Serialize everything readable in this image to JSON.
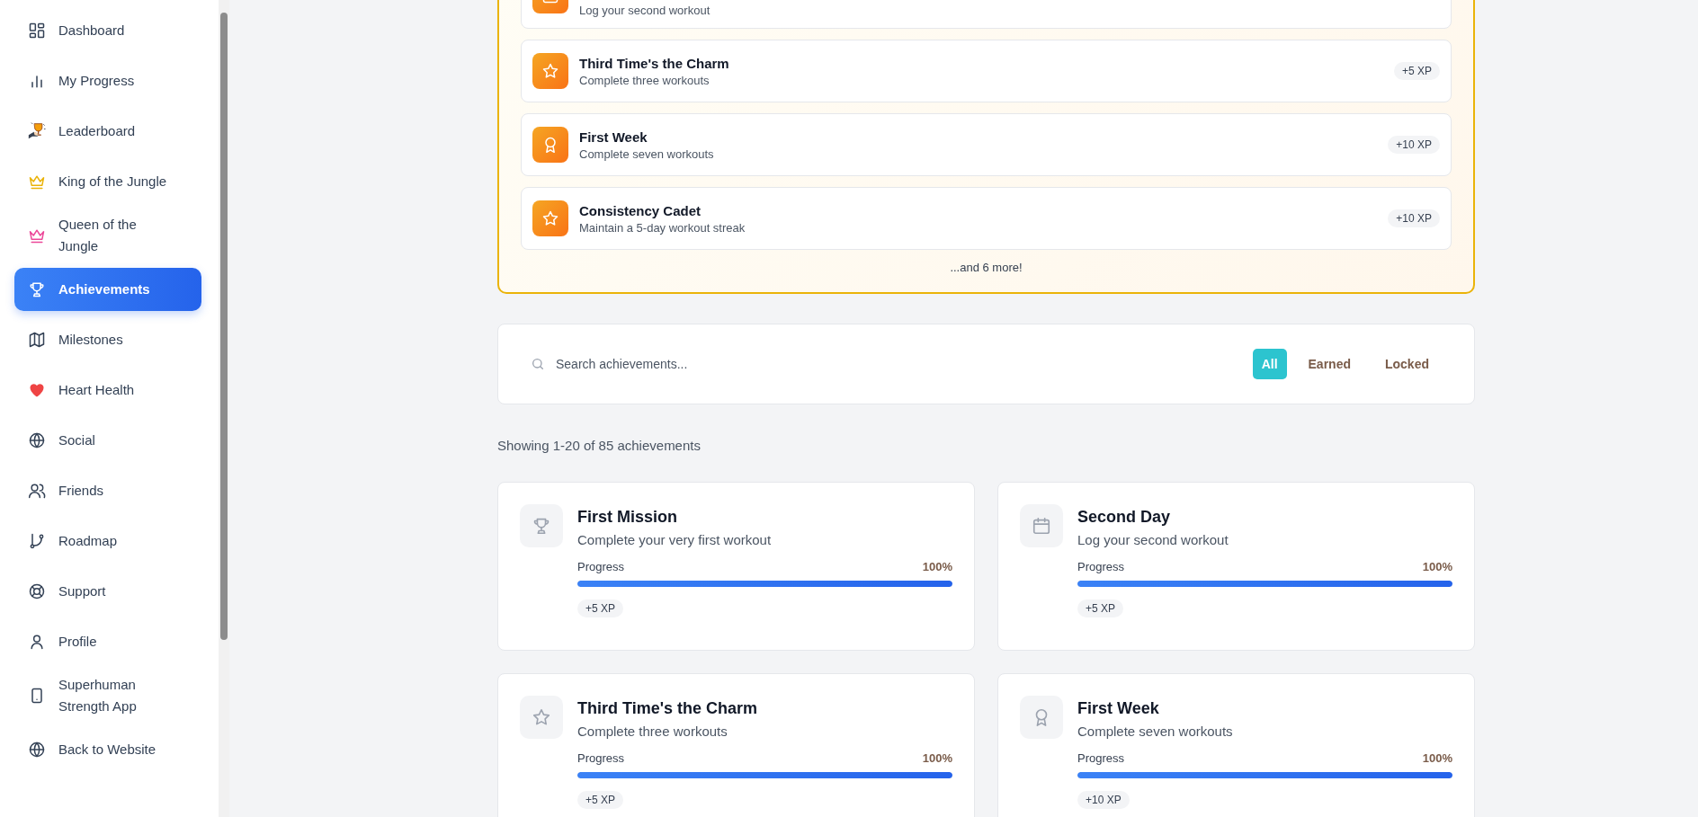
{
  "sidebar": {
    "items": [
      {
        "label": "Dashboard",
        "kind": "grid",
        "selected": false
      },
      {
        "label": "My Progress",
        "kind": "bars",
        "selected": false
      },
      {
        "label": "Leaderboard",
        "kind": "cup",
        "selected": false
      },
      {
        "label": "King of the Jungle",
        "kind": "king",
        "selected": false
      },
      {
        "label": "Queen of the Jungle",
        "kind": "queen",
        "selected": false
      },
      {
        "label": "Achievements",
        "kind": "trophy",
        "selected": true
      },
      {
        "label": "Milestones",
        "kind": "map",
        "selected": false
      },
      {
        "label": "Heart Health",
        "kind": "heart",
        "selected": false
      },
      {
        "label": "Social",
        "kind": "globe",
        "selected": false
      },
      {
        "label": "Friends",
        "kind": "users",
        "selected": false
      },
      {
        "label": "Roadmap",
        "kind": "branch",
        "selected": false
      },
      {
        "label": "Support",
        "kind": "lifebuoy",
        "selected": false
      },
      {
        "label": "Profile",
        "kind": "user",
        "selected": false
      },
      {
        "label": "Superhuman Strength App",
        "kind": "phone",
        "selected": false
      },
      {
        "label": "Back to Website",
        "kind": "globe",
        "selected": false
      }
    ]
  },
  "recent": {
    "items": [
      {
        "kind": "calendar",
        "description": "Log your second workout"
      },
      {
        "kind": "star",
        "title": "Third Time's the Charm",
        "description": "Complete three workouts",
        "xp": "+5 XP"
      },
      {
        "kind": "award",
        "title": "First Week",
        "description": "Complete seven workouts",
        "xp": "+10 XP"
      },
      {
        "kind": "star",
        "title": "Consistency Cadet",
        "description": "Maintain a 5-day workout streak",
        "xp": "+10 XP"
      }
    ],
    "more": "...and 6 more!"
  },
  "search": {
    "placeholder": "Search achievements...",
    "filters": [
      {
        "label": "All",
        "selected": true
      },
      {
        "label": "Earned",
        "selected": false
      },
      {
        "label": "Locked",
        "selected": false
      }
    ]
  },
  "summary": "Showing 1-20 of 85 achievements",
  "achievements": [
    {
      "kind": "trophy",
      "title": "First Mission",
      "description": "Complete your very first workout",
      "progress_label": "Progress",
      "progress_value": "100%",
      "level": 1,
      "xp": "+5 XP"
    },
    {
      "kind": "calendar",
      "title": "Second Day",
      "description": "Log your second workout",
      "progress_label": "Progress",
      "progress_value": "100%",
      "level": 1,
      "xp": "+5 XP"
    },
    {
      "kind": "star",
      "title": "Third Time's the Charm",
      "description": "Complete three workouts",
      "progress_label": "Progress",
      "progress_value": "100%",
      "level": 1,
      "xp": "+5 XP"
    },
    {
      "kind": "award",
      "title": "First Week",
      "description": "Complete seven workouts",
      "progress_label": "Progress",
      "progress_value": "100%",
      "level": 1,
      "xp": "+10 XP"
    }
  ]
}
